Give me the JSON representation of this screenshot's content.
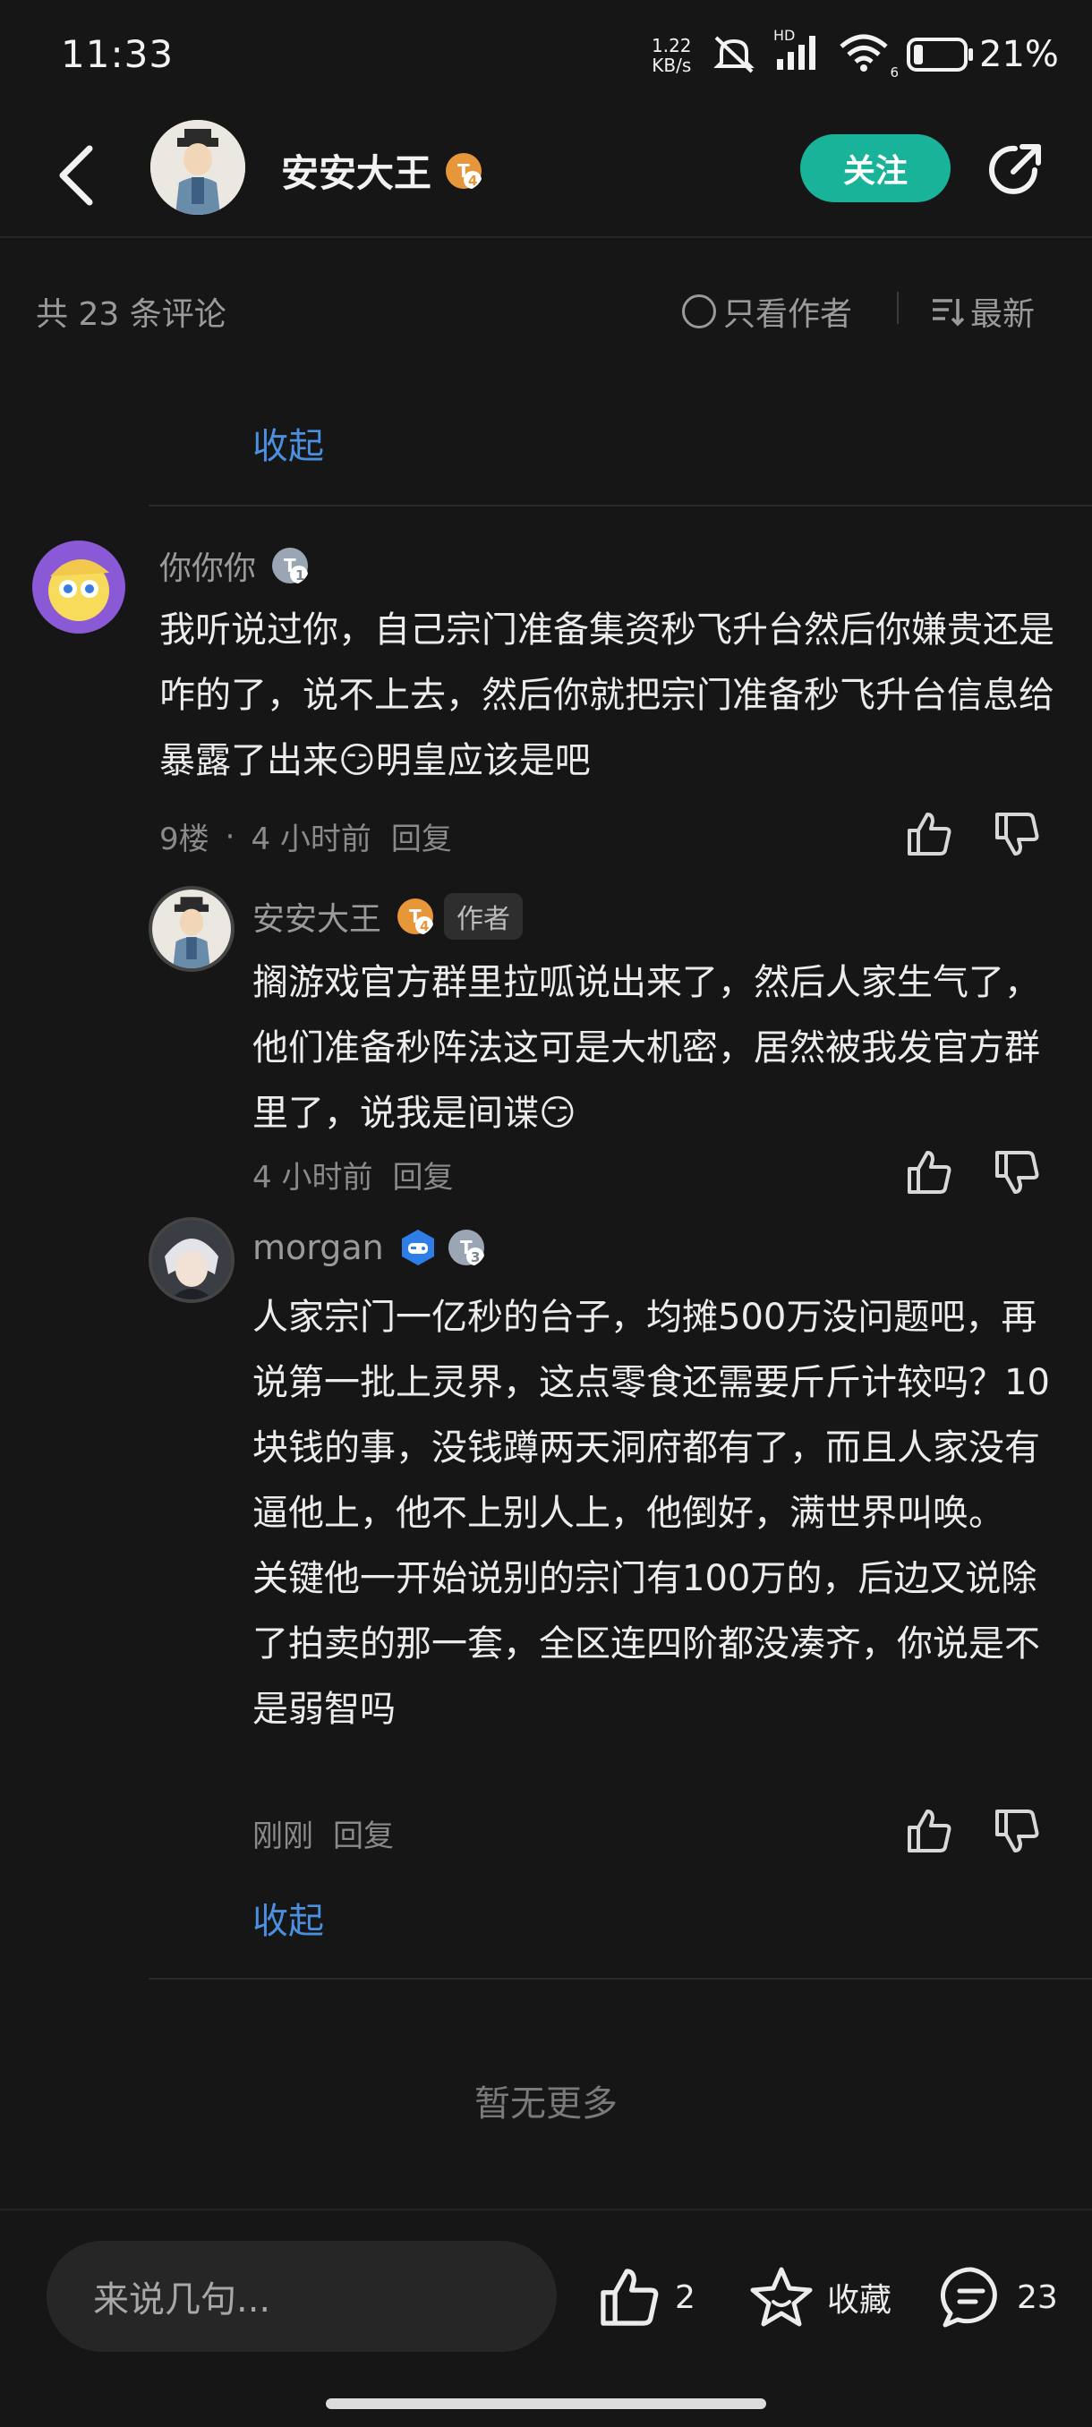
{
  "status_bar": {
    "time": "11:33",
    "net_speed_value": "1.22",
    "net_speed_unit": "KB/s",
    "battery_percent": "21%",
    "wifi_badge": "6",
    "signal_badge": "HD"
  },
  "header": {
    "author_name": "安安大王",
    "author_level": "4",
    "follow_label": "关注"
  },
  "filter_bar": {
    "comment_count": "共 23 条评论",
    "only_author_label": "只看作者",
    "sort_label": "最新"
  },
  "collapse_label": "收起",
  "comments": [
    {
      "username": "你你你",
      "level": "1",
      "text": "我听说过你，自己宗门准备集资秒飞升台然后你嫌贵还是咋的了，说不上去，然后你就把宗门准备秒飞升台信息给暴露了出来😏明皇应该是吧",
      "floor": "9楼",
      "time": "4 小时前",
      "reply_label": "回复"
    }
  ],
  "replies": [
    {
      "username": "安安大王",
      "level": "4",
      "author_tag": "作者",
      "text": "搁游戏官方群里拉呱说出来了，然后人家生气了，他们准备秒阵法这可是大机密，居然被我发官方群里了，说我是间谍😏",
      "time": "4 小时前",
      "reply_label": "回复"
    },
    {
      "username": "morgan",
      "level": "3",
      "text_lines": [
        "人家宗门一亿秒的台子，均摊500万没问题吧，再说第一批上灵界，这点零食还需要斤斤计较吗？10块钱的事，没钱蹲两天洞府都有了，而且人家没有逼他上，他不上别人上，他倒好，满世界叫唤。",
        "关键他一开始说别的宗门有100万的，后边又说除了拍卖的那一套，全区连四阶都没凑齐，你说是不是弱智吗"
      ],
      "time": "刚刚",
      "reply_label": "回复"
    }
  ],
  "no_more": "暂无更多",
  "bottom_bar": {
    "input_placeholder": "来说几句...",
    "like_count": "2",
    "favorite_label": "收藏",
    "comment_count": "23"
  },
  "colors": {
    "background": "#161616",
    "accent_green": "#19b39a",
    "link_blue": "#4a8fe0",
    "level_orange": "#e8963a"
  }
}
